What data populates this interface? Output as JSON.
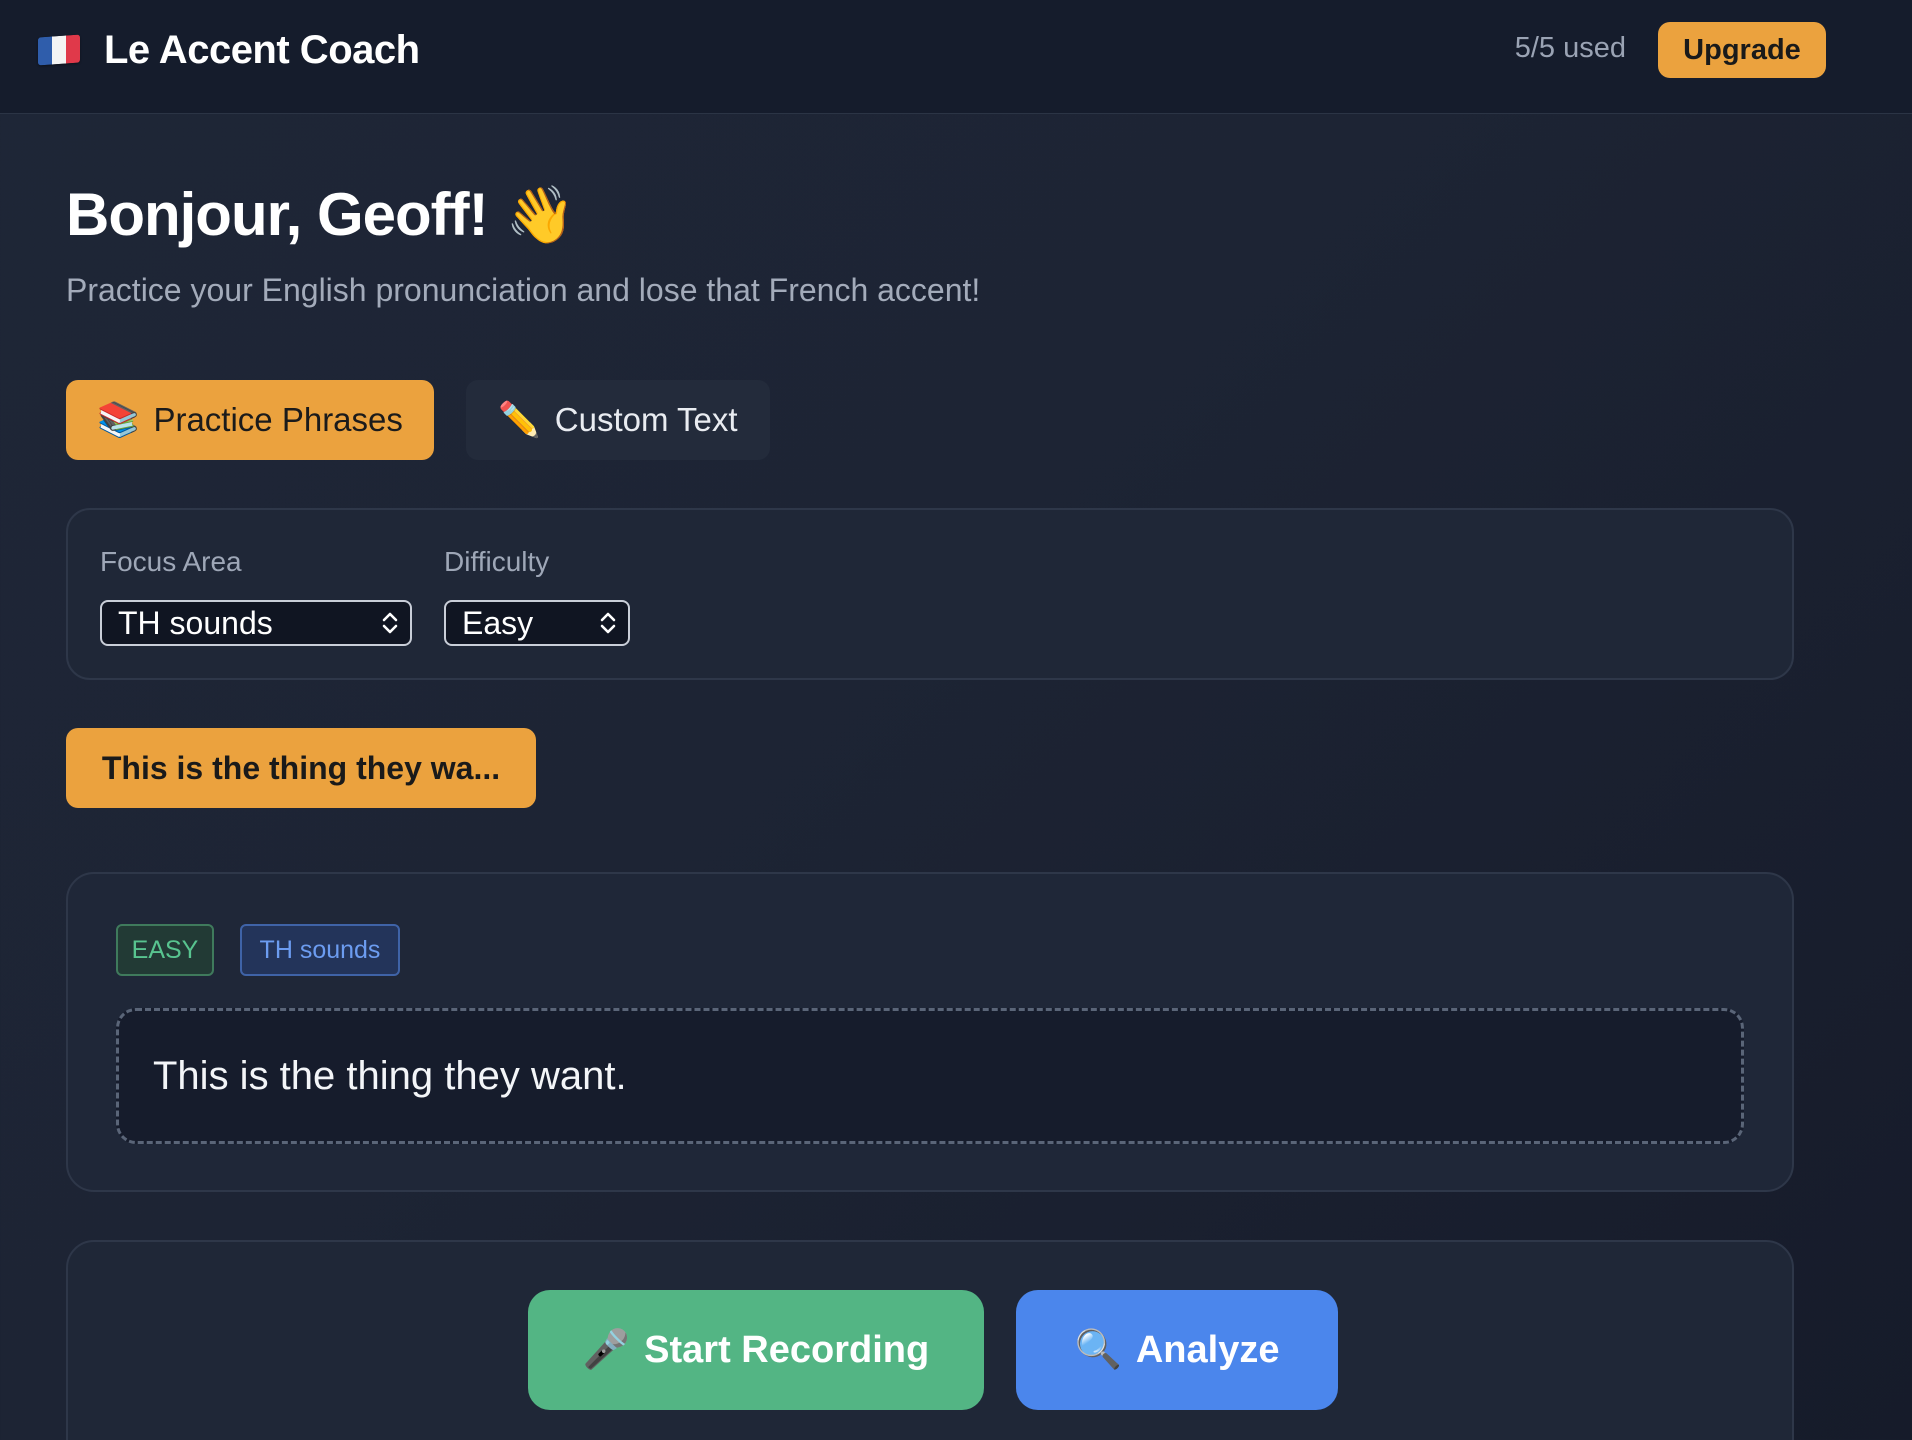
{
  "header": {
    "app_title": "Le Accent Coach",
    "flag_icon": "france-flag-icon",
    "usage": "5/5 used",
    "upgrade_label": "Upgrade"
  },
  "greeting": {
    "title": "Bonjour, Geoff!",
    "wave": "👋",
    "subtitle": "Practice your English pronunciation and lose that French accent!"
  },
  "modes": [
    {
      "icon": "📚",
      "label": "Practice Phrases",
      "active": true
    },
    {
      "icon": "✏️",
      "label": "Custom Text",
      "active": false
    }
  ],
  "filters": {
    "focus_label": "Focus Area",
    "focus_value": "TH sounds",
    "difficulty_label": "Difficulty",
    "difficulty_value": "Easy"
  },
  "phrase_chip": "This is the thing they wa...",
  "phrase_card": {
    "difficulty_badge": "EASY",
    "focus_badge": "TH sounds",
    "text": "This is the thing they want."
  },
  "actions": {
    "record_icon": "🎤",
    "record_label": "Start Recording",
    "analyze_icon": "🔍",
    "analyze_label": "Analyze"
  },
  "colors": {
    "accent": "#eba23e",
    "record": "#53b584",
    "analyze": "#4b86ec",
    "background": "#1d2434"
  }
}
